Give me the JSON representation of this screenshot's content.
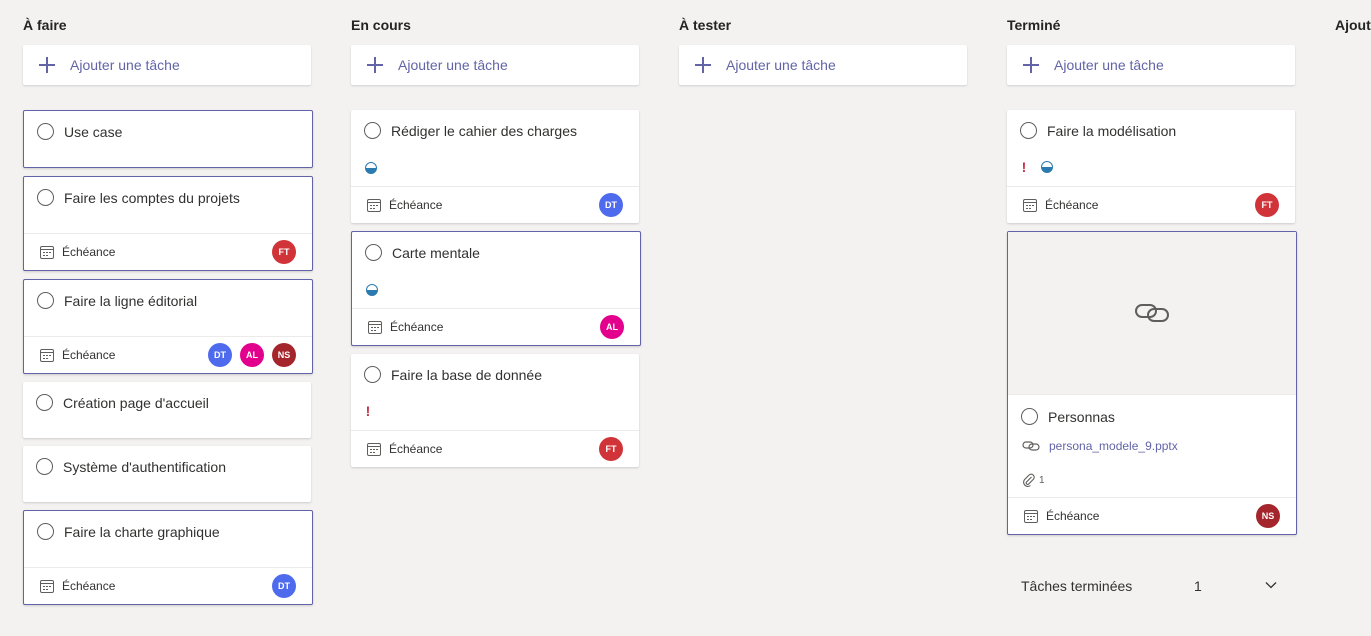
{
  "add_task_label": "Ajouter une tâche",
  "due_label": "Échéance",
  "columns": [
    {
      "title": "À faire"
    },
    {
      "title": "En cours"
    },
    {
      "title": "À tester"
    },
    {
      "title": "Terminé"
    },
    {
      "title": "Ajoute"
    }
  ],
  "cards": {
    "use_case": "Use case",
    "comptes": "Faire les comptes du projets",
    "ligne": "Faire la ligne éditorial",
    "accueil": "Création page d'accueil",
    "auth": "Système d'authentification",
    "charte": "Faire la charte graphique",
    "cahier": "Rédiger le cahier des charges",
    "carte": "Carte mentale",
    "bdd": "Faire la base de donnée",
    "modelisation": "Faire la modélisation",
    "personnas": "Personnas"
  },
  "attachment": {
    "file_name": "persona_modele_9.pptx",
    "count": "1"
  },
  "avatars": {
    "FT": {
      "initials": "FT",
      "color": "#d13438"
    },
    "DT": {
      "initials": "DT",
      "color": "#4f6bed"
    },
    "AL": {
      "initials": "AL",
      "color": "#e3008c"
    },
    "NS": {
      "initials": "NS",
      "color": "#a4262c"
    }
  },
  "completed": {
    "label": "Tâches terminées",
    "count": "1"
  },
  "colors": {
    "accent": "#6264a7",
    "priority": "#c4314b",
    "progress": "#2b7ab0",
    "background": "#f3f2f1"
  }
}
